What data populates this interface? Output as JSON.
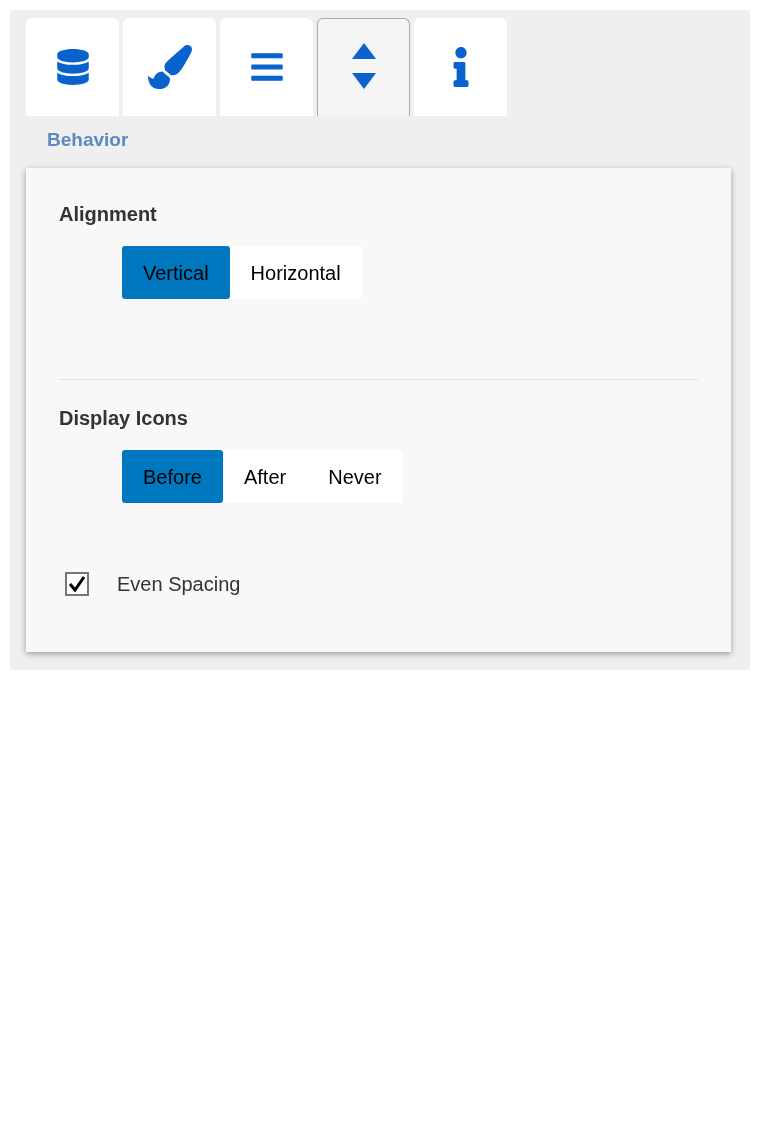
{
  "tabs": [
    {
      "kind": "database",
      "selected": false
    },
    {
      "kind": "brush",
      "selected": false
    },
    {
      "kind": "list",
      "selected": false
    },
    {
      "kind": "sort",
      "selected": true
    },
    {
      "kind": "info",
      "selected": false
    }
  ],
  "section_title": "Behavior",
  "groups": [
    {
      "title": "Alignment",
      "options": [
        {
          "label": "Vertical",
          "selected": true
        },
        {
          "label": "Horizontal",
          "selected": false
        }
      ]
    },
    {
      "title": "Display Icons",
      "options": [
        {
          "label": "Before",
          "selected": true
        },
        {
          "label": "After",
          "selected": false
        },
        {
          "label": "Never",
          "selected": false
        }
      ]
    }
  ],
  "checkbox": {
    "label": "Even Spacing",
    "checked": true
  }
}
